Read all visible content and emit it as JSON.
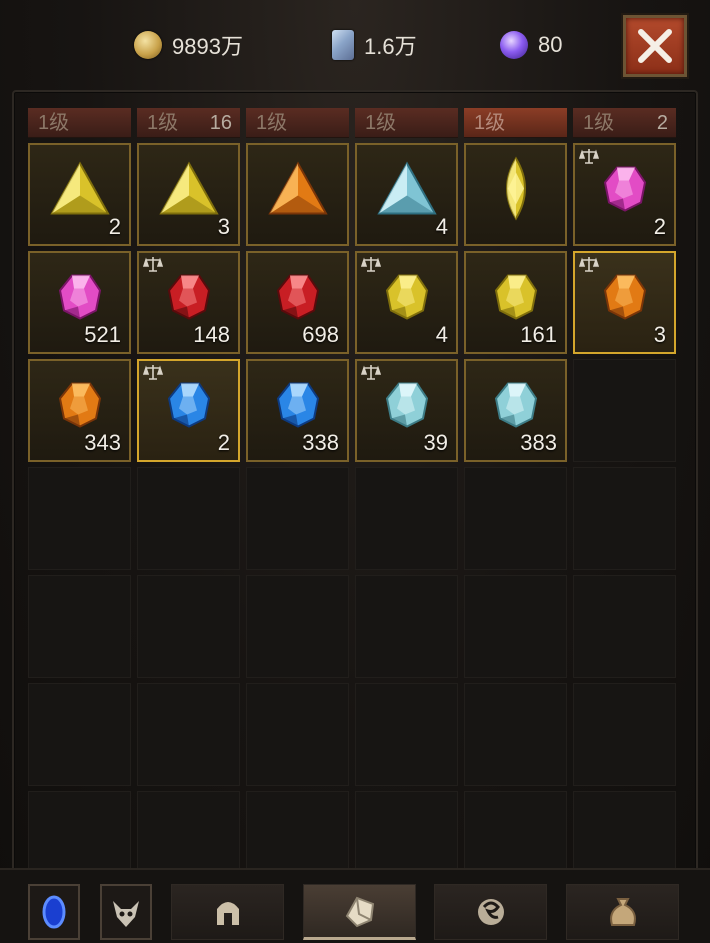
{
  "currencies": {
    "gold": {
      "value": "9893万",
      "icon": "gold-coin-icon"
    },
    "crystal": {
      "value": "1.6万",
      "icon": "crystal-shard-icon"
    },
    "orb": {
      "value": "80",
      "icon": "purple-orb-icon"
    }
  },
  "close_icon": "close-x-icon",
  "tabs": [
    {
      "label": "1级",
      "count": ""
    },
    {
      "label": "1级",
      "count": "16"
    },
    {
      "label": "1级",
      "count": ""
    },
    {
      "label": "1级",
      "count": ""
    },
    {
      "label": "1级",
      "count": ""
    },
    {
      "label": "1级",
      "count": "2"
    }
  ],
  "items": [
    {
      "icon": "yellow-triangle-gem-icon",
      "qty": "2",
      "scale": false
    },
    {
      "icon": "yellow-triangle-gem-icon",
      "qty": "3",
      "scale": false
    },
    {
      "icon": "orange-triangle-gem-icon",
      "qty": "",
      "scale": false
    },
    {
      "icon": "cyan-triangle-gem-icon",
      "qty": "4",
      "scale": false
    },
    {
      "icon": "yellow-marquise-gem-icon",
      "qty": "",
      "scale": false
    },
    {
      "icon": "pink-gem-icon",
      "qty": "2",
      "scale": true
    },
    {
      "icon": "pink-gem-icon",
      "qty": "521",
      "scale": false
    },
    {
      "icon": "red-gem-icon",
      "qty": "148",
      "scale": true
    },
    {
      "icon": "red-gem-icon",
      "qty": "698",
      "scale": false
    },
    {
      "icon": "yellow-gem-icon",
      "qty": "4",
      "scale": true
    },
    {
      "icon": "yellow-gem-icon",
      "qty": "161",
      "scale": false
    },
    {
      "icon": "orange-gem-icon",
      "qty": "3",
      "scale": true
    },
    {
      "icon": "orange-gem-icon",
      "qty": "343",
      "scale": false
    },
    {
      "icon": "blue-gem-icon",
      "qty": "2",
      "scale": true
    },
    {
      "icon": "blue-gem-icon",
      "qty": "338",
      "scale": false
    },
    {
      "icon": "aqua-gem-icon",
      "qty": "39",
      "scale": true
    },
    {
      "icon": "aqua-gem-icon",
      "qty": "383",
      "scale": false
    }
  ],
  "bottom": {
    "buttons": [
      {
        "icon": "blue-portal-icon"
      },
      {
        "icon": "demon-mask-icon"
      },
      {
        "icon": "helmet-icon"
      },
      {
        "icon": "gem-crafting-icon"
      },
      {
        "icon": "swirl-rune-icon"
      },
      {
        "icon": "loot-bag-icon"
      }
    ]
  }
}
